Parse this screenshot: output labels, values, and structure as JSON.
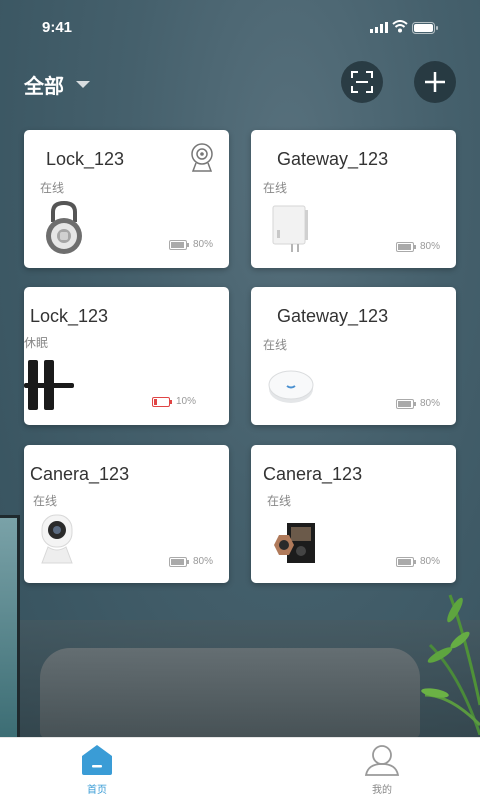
{
  "status_bar": {
    "time": "9:41"
  },
  "header": {
    "filter_label": "全部"
  },
  "devices": [
    {
      "name": "Lock_123",
      "status": "在线",
      "battery": "80%",
      "battery_level": 0.8,
      "low": false
    },
    {
      "name": "Gateway_123",
      "status": "在线",
      "battery": "80%",
      "battery_level": 0.8,
      "low": false
    },
    {
      "name": "Lock_123",
      "status": "休眠",
      "battery": "10%",
      "battery_level": 0.1,
      "low": true
    },
    {
      "name": "Gateway_123",
      "status": "在线",
      "battery": "80%",
      "battery_level": 0.8,
      "low": false
    },
    {
      "name": "Canera_123",
      "status": "在线",
      "battery": "80%",
      "battery_level": 0.8,
      "low": false
    },
    {
      "name": "Canera_123",
      "status": "在线",
      "battery": "80%",
      "battery_level": 0.8,
      "low": false
    }
  ],
  "tabs": {
    "home": "首页",
    "mine": "我的"
  },
  "colors": {
    "accent": "#3a9cd6",
    "low_battery": "#e04545",
    "card_bg": "#ffffff"
  }
}
